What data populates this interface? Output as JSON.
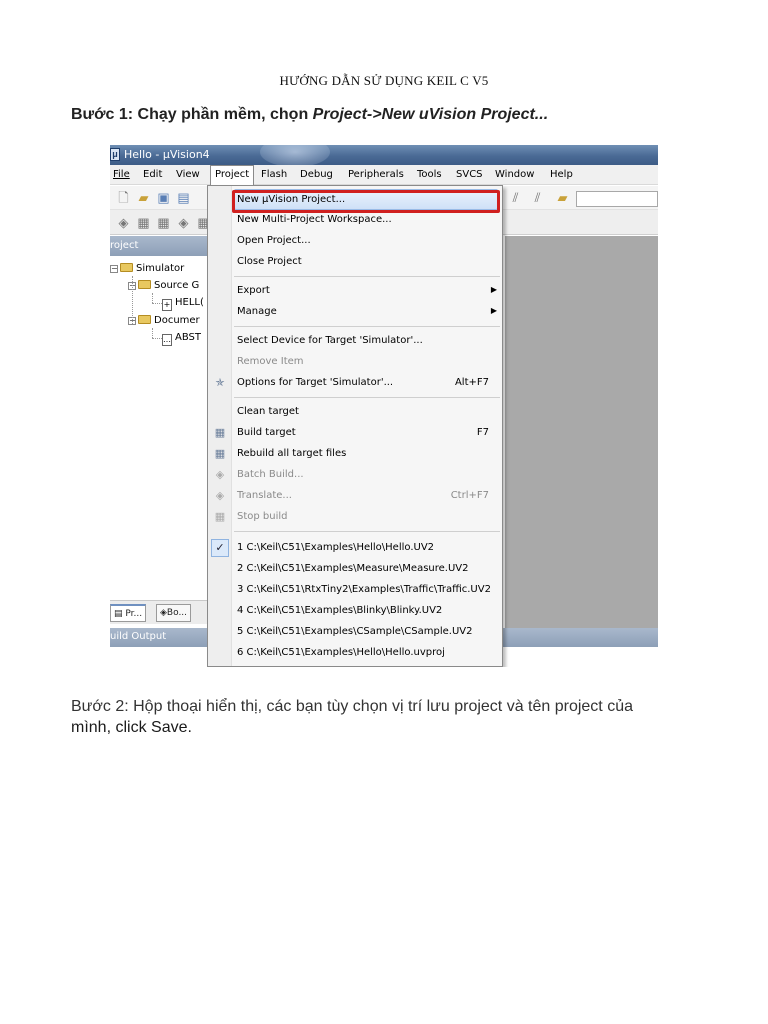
{
  "doc": {
    "title": "HƯỚNG DẪN SỬ DỤNG KEIL C V5",
    "step1_prefix": "Bước 1: Chạy phần mềm, chọn ",
    "step1_path": "Project->New uVision Project...",
    "step2_text": "Bước 2: Hộp thoại hiển thị, các bạn tùy chọn vị trí lưu project và tên project của",
    "step2_text2": "mình, click Save."
  },
  "app": {
    "title": "Hello  - µVision4",
    "menu": [
      "File",
      "Edit",
      "View",
      "Project",
      "Flash",
      "Debug",
      "Peripherals",
      "Tools",
      "SVCS",
      "Window",
      "Help"
    ],
    "active_menu": "Project",
    "project_panel_title": "roject",
    "tree": {
      "root": "Simulator",
      "group1": "Source G",
      "file1": "HELL(",
      "group2": "Documer",
      "file2": "ABST"
    },
    "bottom_tabs": [
      "Pr...",
      "Bo..."
    ],
    "build_output_label": "uild Output"
  },
  "dropdown": {
    "items": [
      {
        "label": "New µVision Project...",
        "highlighted": true
      },
      {
        "label": "New Multi-Project Workspace..."
      },
      {
        "label": "Open Project..."
      },
      {
        "label": "Close Project"
      },
      {
        "label": "Export",
        "submenu": true
      },
      {
        "label": "Manage",
        "submenu": true
      },
      {
        "label": "Select Device for Target 'Simulator'..."
      },
      {
        "label": "Remove Item",
        "disabled": true
      },
      {
        "label": "Options for Target 'Simulator'...",
        "shortcut": "Alt+F7",
        "icon": "options-wand-icon"
      },
      {
        "label": "Clean target"
      },
      {
        "label": "Build target",
        "shortcut": "F7",
        "icon": "build-icon"
      },
      {
        "label": "Rebuild all target files",
        "icon": "rebuild-icon"
      },
      {
        "label": "Batch Build...",
        "disabled": true,
        "icon": "batch-build-icon"
      },
      {
        "label": "Translate...",
        "shortcut": "Ctrl+F7",
        "disabled": true,
        "icon": "translate-icon"
      },
      {
        "label": "Stop build",
        "disabled": true,
        "icon": "stop-build-icon"
      },
      {
        "label": "1 C:\\Keil\\C51\\Examples\\Hello\\Hello.UV2",
        "checked": true
      },
      {
        "label": "2 C:\\Keil\\C51\\Examples\\Measure\\Measure.UV2"
      },
      {
        "label": "3 C:\\Keil\\C51\\RtxTiny2\\Examples\\Traffic\\Traffic.UV2"
      },
      {
        "label": "4 C:\\Keil\\C51\\Examples\\Blinky\\Blinky.UV2"
      },
      {
        "label": "5 C:\\Keil\\C51\\Examples\\CSample\\CSample.UV2"
      },
      {
        "label": "6 C:\\Keil\\C51\\Examples\\Hello\\Hello.uvproj"
      }
    ]
  },
  "colors": {
    "highlight_border": "#d0201f",
    "titlebar": "#4a6a95"
  }
}
